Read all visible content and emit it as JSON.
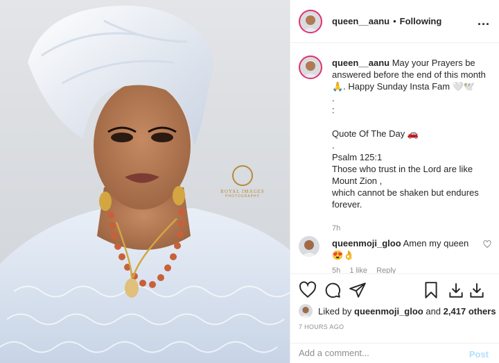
{
  "post": {
    "username": "queen__aanu",
    "separator": "•",
    "follow_status": "Following",
    "more": "..."
  },
  "caption": {
    "username": "queen__aanu",
    "lines": [
      "May your Prayers be answered before the end of this month 🙏. Happy Sunday Insta Fam 🤍🕊️",
      ".",
      ":",
      "",
      "Quote Of The Day 🚗",
      ".",
      "Psalm 125:1",
      "Those who trust in the Lord are like Mount Zion ,",
      "which cannot be shaken but endures forever."
    ],
    "time": "7h"
  },
  "comment": {
    "username": "queenmoji_gloo",
    "text": "Amen my queen",
    "emoji": "😍👌",
    "time": "5h",
    "likes": "1 like",
    "reply": "Reply"
  },
  "likes": {
    "prefix": "Liked by",
    "user": "queenmoji_gloo",
    "and": "and",
    "count": "2,417 others"
  },
  "timestamp": "7 HOURS AGO",
  "add_comment": {
    "placeholder": "Add a comment...",
    "post_label": "Post"
  },
  "watermark": {
    "title": "ROYAL IMAGES",
    "subtitle": "PHOTOGRAPHY"
  }
}
